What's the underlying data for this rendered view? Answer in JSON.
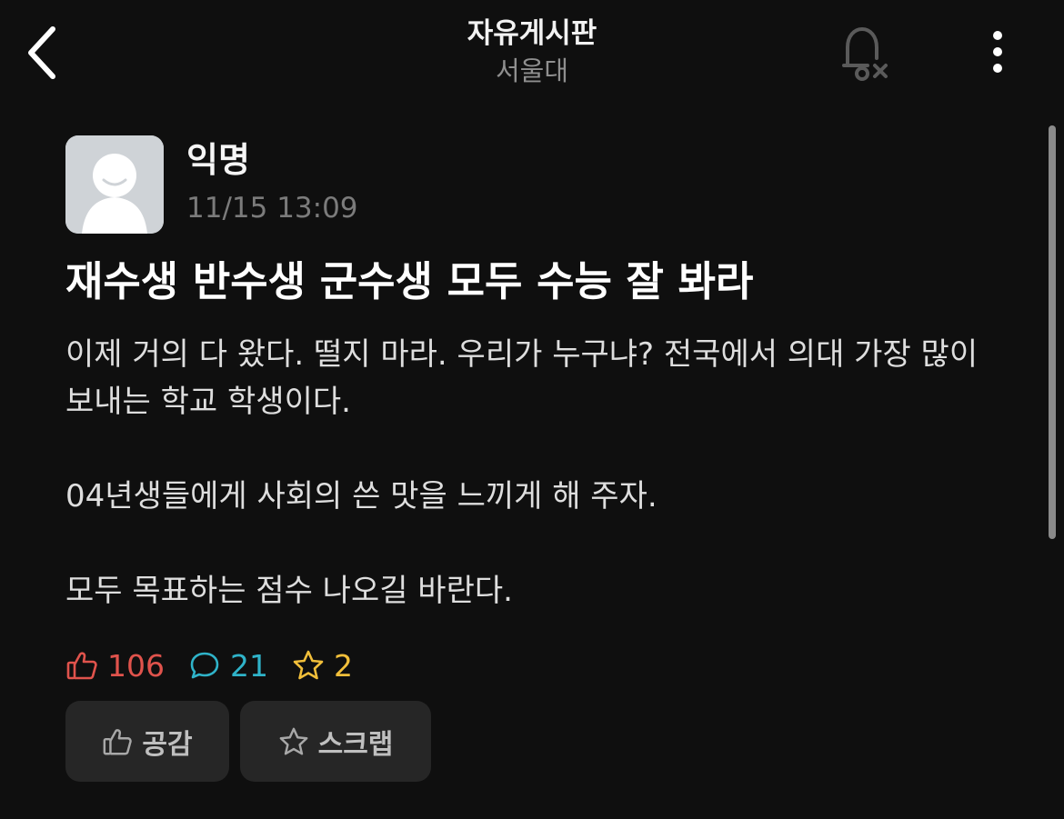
{
  "header": {
    "board_title": "자유게시판",
    "board_sub": "서울대"
  },
  "post": {
    "author": "익명",
    "time": "11/15 13:09",
    "title": "재수생 반수생 군수생 모두 수능 잘 봐라",
    "body": [
      "이제 거의 다 왔다. 떨지 마라. 우리가 누구냐? 전국에서 의대 가장 많이 보내는 학교 학생이다.",
      "04년생들에게 사회의 쓴 맛을 느끼게 해 주자.",
      "모두 목표하는 점수 나오길 바란다."
    ]
  },
  "stats": {
    "likes": "106",
    "comments": "21",
    "scraps": "2"
  },
  "actions": {
    "like_label": "공감",
    "scrap_label": "스크랩"
  },
  "icons": {
    "back": "chevron-left-icon",
    "bell": "bell-off-icon",
    "more": "more-vertical-icon",
    "like": "thumbs-up-icon",
    "comment": "comment-icon",
    "scrap": "star-icon"
  },
  "colors": {
    "background": "#0f0f0f",
    "like": "#e0534c",
    "comment": "#2fb3c9",
    "scrap": "#f2bf3a",
    "button_bg": "#262626"
  }
}
